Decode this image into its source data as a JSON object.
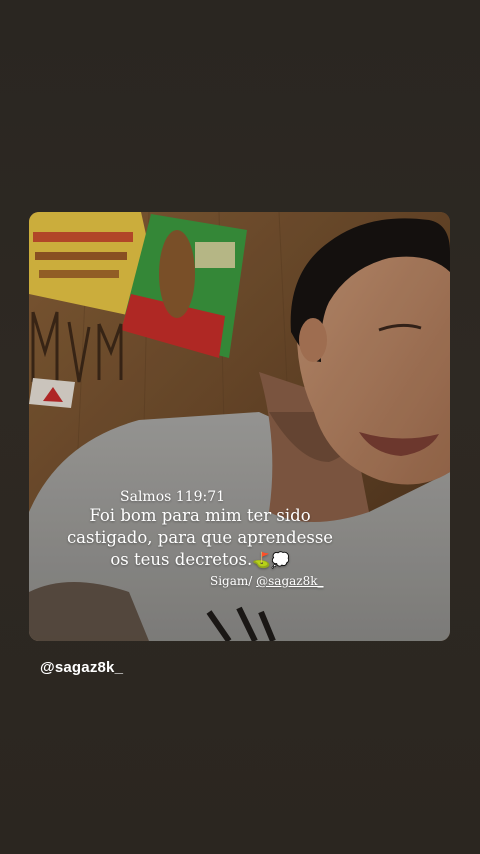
{
  "story": {
    "quote": {
      "reference": "Salmos 119:71",
      "line1": "Foi bom para mim ter sido",
      "line2": "castigado, para que aprendesse",
      "line3": "os teus decretos.",
      "emoji": "⛳💭"
    },
    "follow": {
      "prefix": "Sigam/ ",
      "handle": "@sagaz8k_"
    },
    "username": "@sagaz8k_"
  },
  "colors": {
    "background": "#2b2722",
    "text": "#ffffff"
  }
}
